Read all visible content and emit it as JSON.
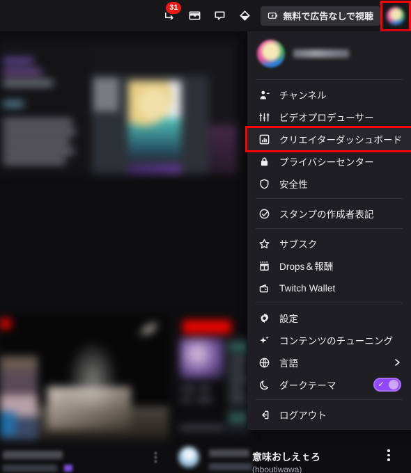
{
  "theme": {
    "nav_bg": "#18181b",
    "menu_bg": "#1f1f23",
    "page_bg": "#0e0e10",
    "text": "#efeff1",
    "muted": "#adadb8",
    "accent_purple": "#9147ff",
    "badge_red": "#e91916",
    "highlight_red": "#ff0000",
    "live_red": "#eb0400"
  },
  "topnav": {
    "notifications": {
      "name": "notifications-icon",
      "badge": "31"
    },
    "whispers": {
      "name": "whispers-icon"
    },
    "chat": {
      "name": "chat-icon"
    },
    "bits": {
      "name": "bits-icon"
    },
    "turbo_button": {
      "label": "無料で広告なしで視聴",
      "icon": "turbo-icon"
    },
    "avatar": {
      "name": "user-avatar",
      "highlighted": true
    }
  },
  "menu": {
    "profile": {
      "username": "",
      "username_redacted": true
    },
    "groups": [
      {
        "items": [
          {
            "icon": "channel-icon",
            "label": "チャンネル"
          },
          {
            "icon": "video-producer-icon",
            "label": "ビデオプロデューサー"
          },
          {
            "icon": "creator-dashboard-icon",
            "label": "クリエイターダッシュボード",
            "highlighted": true
          },
          {
            "icon": "privacy-lock-icon",
            "label": "プライバシーセンター"
          },
          {
            "icon": "safety-shield-icon",
            "label": "安全性"
          }
        ]
      },
      {
        "items": [
          {
            "icon": "emote-credit-icon",
            "label": "スタンプの作成者表記"
          }
        ]
      },
      {
        "items": [
          {
            "icon": "subscriptions-star-icon",
            "label": "サブスク"
          },
          {
            "icon": "drops-rewards-icon",
            "label": "Drops＆報酬"
          },
          {
            "icon": "wallet-icon",
            "label": "Twitch Wallet"
          }
        ]
      },
      {
        "items": [
          {
            "icon": "settings-gear-icon",
            "label": "設定"
          },
          {
            "icon": "content-tuning-sparkle-icon",
            "label": "コンテンツのチューニング"
          },
          {
            "icon": "language-globe-icon",
            "label": "言語",
            "trailing": "chevron-right-icon"
          },
          {
            "icon": "dark-theme-moon-icon",
            "label": "ダークテーマ",
            "trailing": "toggle-switch",
            "toggle_on": true
          }
        ]
      },
      {
        "items": [
          {
            "icon": "logout-icon",
            "label": "ログアウト"
          }
        ]
      }
    ]
  },
  "background": {
    "visible_card": {
      "title": "意味おしえｔろ",
      "subtitle": "(hboutiwawa)",
      "more_options": "more-options-icon"
    }
  }
}
